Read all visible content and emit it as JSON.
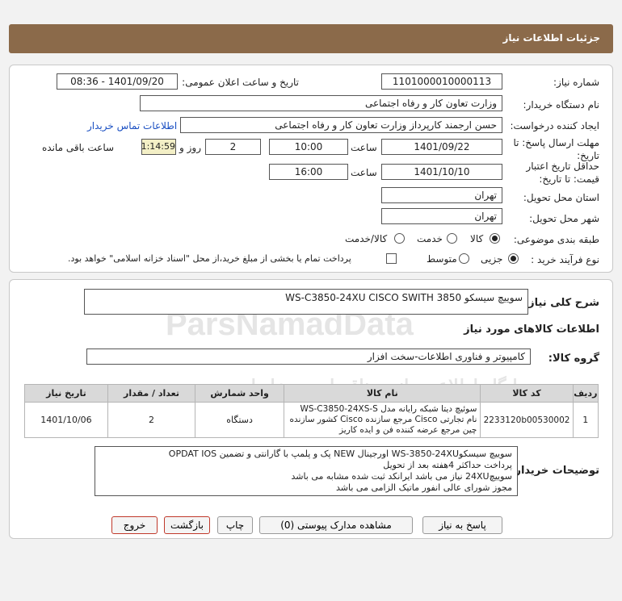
{
  "header": {
    "title": "جزئیات اطلاعات نیاز"
  },
  "form": {
    "need_number_label": "شماره نیاز:",
    "need_number": "1101000010000113",
    "announce_label": "تاریخ و ساعت اعلان عمومی:",
    "announce_value": "1401/09/20 - 08:36",
    "buyer_org_label": "نام دستگاه خریدار:",
    "buyer_org": "وزارت تعاون کار و رفاه اجتماعی",
    "requester_label": "ایجاد کننده درخواست:",
    "requester": "حسن ارجمند کارپرداز وزارت تعاون کار و رفاه اجتماعی",
    "contact_link": "اطلاعات تماس خریدار",
    "reply_deadline_label_1": "مهلت ارسال پاسخ: تا",
    "reply_deadline_label_2": "تاریخ:",
    "reply_date": "1401/09/22",
    "time_label": "ساعت",
    "reply_time": "10:00",
    "days_value": "2",
    "days_label": "روز و",
    "remaining_time": "01:14:59",
    "remaining_label": "ساعت باقی مانده",
    "validity_label_1": "حداقل تاریخ اعتبار",
    "validity_label_2": "قیمت: تا تاریخ:",
    "validity_date": "1401/10/10",
    "validity_time": "16:00",
    "province_label": "استان محل تحویل:",
    "province": "تهران",
    "city_label": "شهر محل تحویل:",
    "city": "تهران",
    "category_label": "طبقه بندی موضوعی:",
    "category_options": [
      "کالا",
      "خدمت",
      "کالا/خدمت"
    ],
    "process_label": "نوع فرآیند خرید :",
    "process_options": [
      "جزیی",
      "متوسط"
    ],
    "treasury_note": "پرداخت تمام یا بخشی از مبلغ خرید،از محل \"اسناد خزانه اسلامی\" خواهد بود."
  },
  "summary": {
    "title_label": "شرح کلی نیاز:",
    "title_value": "سوییچ سیسکو WS-C3850-24XU  CISCO SWITH 3850",
    "items_heading": "اطلاعات کالاهای مورد نیاز",
    "group_label": "گروه کالا:",
    "group_value": "کامپیوتر و فناوری اطلاعات-سخت افزار"
  },
  "table": {
    "headers": [
      "ردیف",
      "کد کالا",
      "نام کالا",
      "واحد شمارش",
      "تعداد / مقدار",
      "تاریخ نیاز"
    ],
    "rows": [
      {
        "row": "1",
        "code": "2233120b00530002",
        "name": "سوئیچ دیتا شبکه رایانه مدل WS-C3850-24XS-S نام تجارتی Cisco مرجع سازنده Cisco کشور سازنده چین مرجع عرضه کننده فن و ایده کاریز",
        "unit": "دستگاه",
        "qty": "2",
        "date": "1401/10/06"
      }
    ]
  },
  "buyer_notes": {
    "label": "توضیحات خریدار:",
    "lines": [
      "سوییچ سیسکوWS-3850-24XU   اورجینال NEW پک و پلمپ با گارانتی و تضمین OPDAT IOS",
      "پرداخت حداکثر 4هفته بعد از تحویل",
      "سوییچ24XU نیاز می باشد ایرانکد ثبت شده مشابه می باشد",
      "مجوز شورای عالی انفور ماتیک الزامی می باشد"
    ]
  },
  "buttons": {
    "reply": "پاسخ به نیاز",
    "docs": "مشاهده مدارک پیوستی (0)",
    "print": "چاپ",
    "back": "بازگشت",
    "exit": "خروج"
  },
  "watermark": {
    "brand": "ParsNamadData",
    "fa_line1": "پایگاه اطلاع رسانی مناقصات و مزایدات",
    "fa_line2": "پارس نماد داده"
  },
  "colors": {
    "header": "#8b6a4a",
    "link": "#1a4fc2",
    "remaining_bg": "#f3efc6",
    "exit_border": "#c0392b"
  }
}
